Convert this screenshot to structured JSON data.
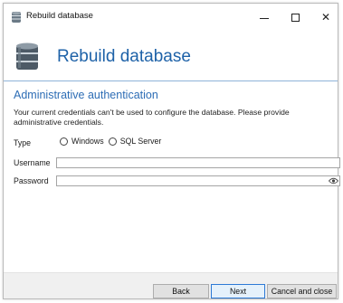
{
  "window": {
    "title": "Rebuild database",
    "minimize_glyph": "",
    "maximize_glyph": "",
    "close_glyph": "✕"
  },
  "header": {
    "title": "Rebuild database",
    "icon": "database-icon"
  },
  "section": {
    "title": "Administrative authentication",
    "description": "Your current credentials can't be used to configure the database. Please provide administrative credentials."
  },
  "form": {
    "type_label": "Type",
    "type_options": [
      "Windows",
      "SQL Server"
    ],
    "username_label": "Username",
    "username_value": "",
    "password_label": "Password",
    "password_value": "",
    "reveal_icon": "eye-icon"
  },
  "footer": {
    "back_label": "Back",
    "next_label": "Next",
    "cancel_label": "Cancel and close"
  },
  "colors": {
    "accent": "#1e62a8",
    "section_title": "#2d6db5",
    "primary_button_border": "#2d7ad6"
  }
}
